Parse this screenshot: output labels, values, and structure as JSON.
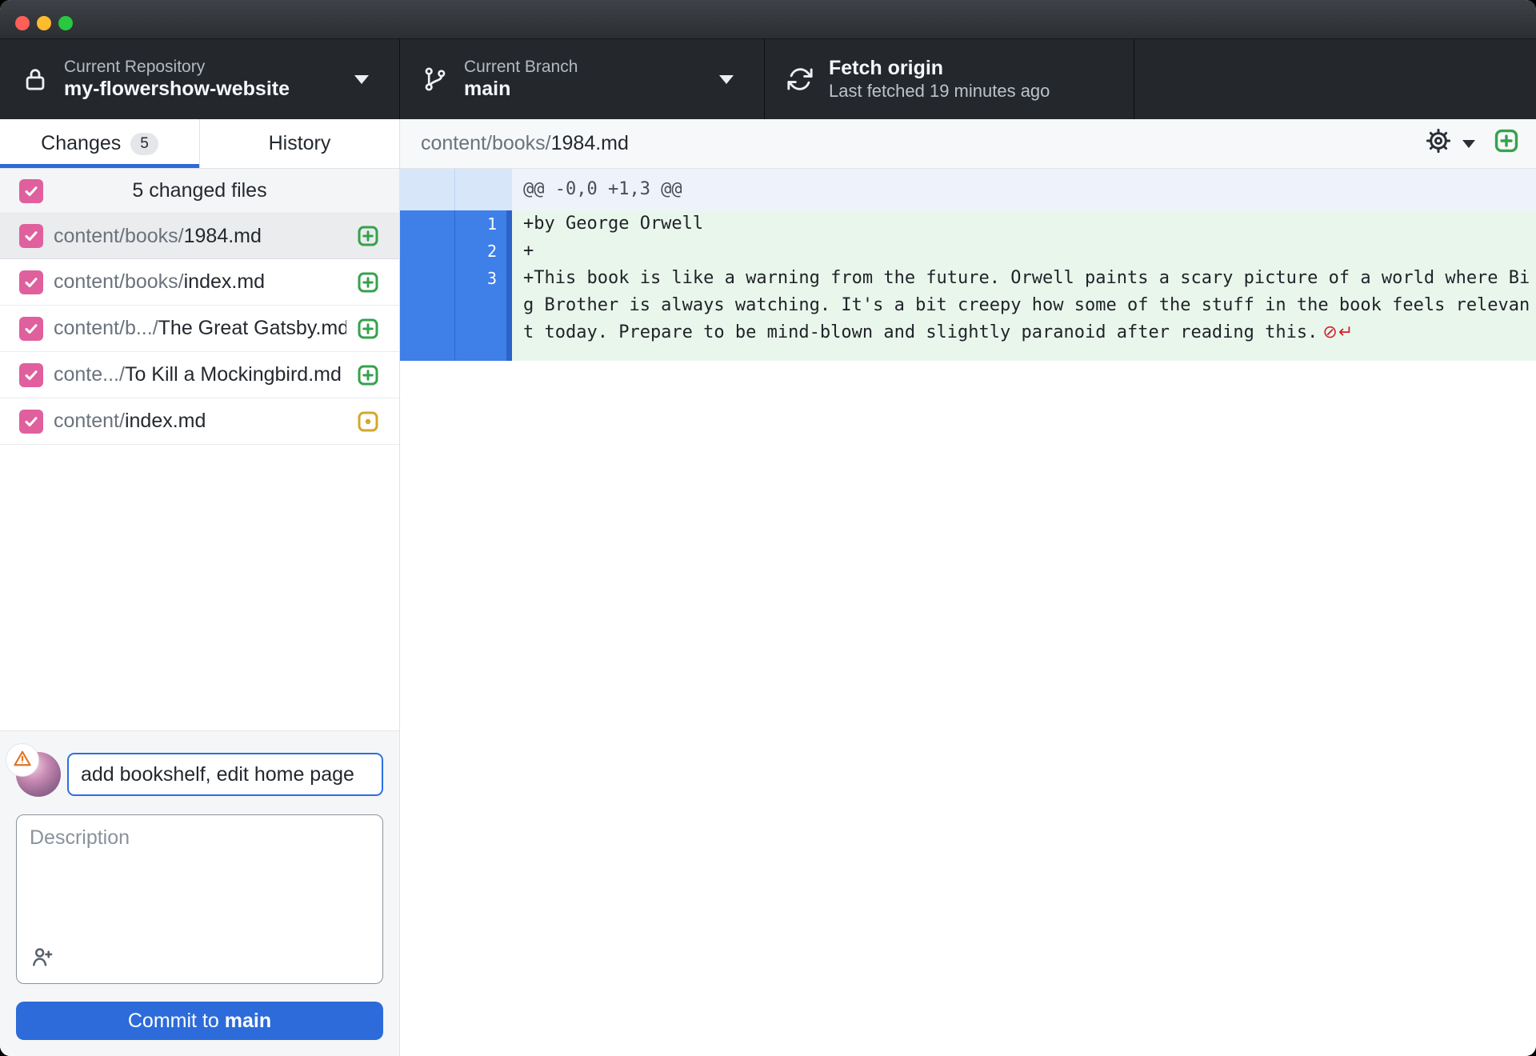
{
  "toolbar": {
    "repository": {
      "label": "Current Repository",
      "value": "my-flowershow-website"
    },
    "branch": {
      "label": "Current Branch",
      "value": "main"
    },
    "fetch": {
      "title": "Fetch origin",
      "subtitle": "Last fetched 19 minutes ago"
    }
  },
  "sidebar": {
    "tabs": [
      {
        "label": "Changes",
        "badge": "5"
      },
      {
        "label": "History"
      }
    ],
    "select_all_label": "5 changed files",
    "files": [
      {
        "path_prefix": "content/books/",
        "name": "1984.md",
        "status": "added",
        "checked": true,
        "selected": true
      },
      {
        "path_prefix": "content/books/",
        "name": "index.md",
        "status": "added",
        "checked": true
      },
      {
        "path_prefix": "content/b.../",
        "name": "The Great Gatsby.md",
        "status": "added",
        "checked": true
      },
      {
        "path_prefix": "conte.../",
        "name": "To Kill a Mockingbird.md",
        "status": "added",
        "checked": true
      },
      {
        "path_prefix": "content/",
        "name": "index.md",
        "status": "modified",
        "checked": true
      }
    ],
    "commit": {
      "summary_value": "add bookshelf, edit home page",
      "description_placeholder": "Description",
      "button_prefix": "Commit to",
      "button_branch": "main"
    }
  },
  "diff": {
    "file_path_prefix": "content/books/",
    "file_name": "1984.md",
    "hunk_header": "@@ -0,0 +1,3 @@",
    "no_newline_marker": "⊘↵",
    "lines": [
      {
        "new_number": "1",
        "text": "+by George Orwell"
      },
      {
        "new_number": "2",
        "text": "+"
      },
      {
        "new_number": "3",
        "text": "+This book is like a warning from the future. Orwell paints a scary picture of a world where Big Brother is always watching. It's a bit creepy how some of the stuff in the book feels relevant today. Prepare to be mind-blown and slightly paranoid after reading this.",
        "no_newline": true
      }
    ]
  },
  "colors": {
    "accent_blue": "#2c6bd9",
    "tab_underline_blue": "#2e6bd6",
    "selected_gutter_blue": "#3e7fe8",
    "checkbox_pink": "#e0609e",
    "added_green": "#35a24d",
    "modified_yellow": "#d4a72c",
    "added_line_bg": "#e9f6ec",
    "warning_orange": "#dd7524",
    "no_newline_red": "#cf222e",
    "traffic_close": "#ff5f57",
    "traffic_minimize": "#febc2e",
    "traffic_zoom": "#28c840"
  }
}
